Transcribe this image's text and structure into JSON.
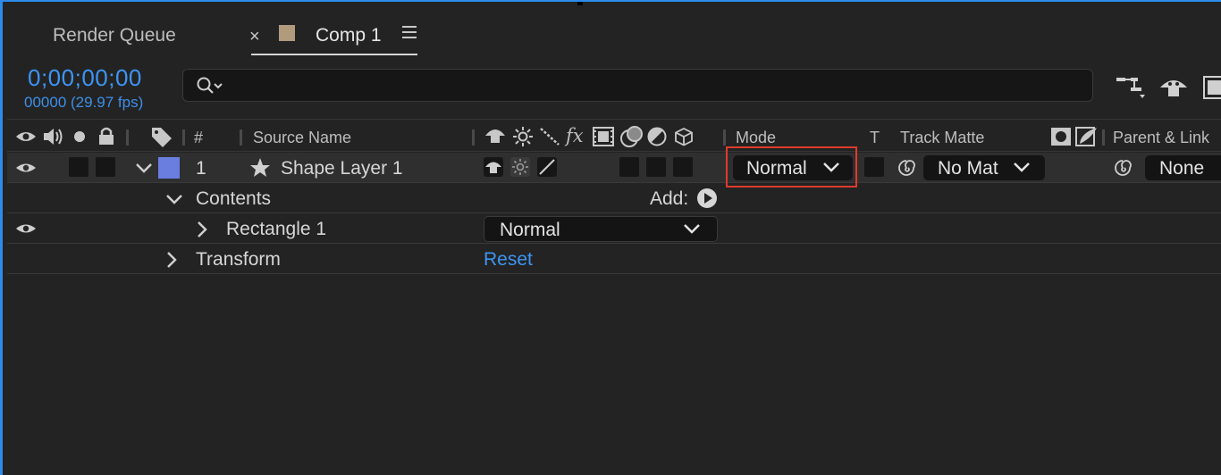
{
  "tabs": {
    "render_queue": "Render Queue",
    "close_glyph": "×",
    "comp": "Comp 1",
    "comp_color": "#b09b7d"
  },
  "timecode": "0;00;00;00",
  "frame_info": "00000 (29.97 fps)",
  "search": {
    "value": "",
    "placeholder": ""
  },
  "columns": {
    "hash": "#",
    "source_name": "Source Name",
    "fx": "fx",
    "mode": "Mode",
    "t": "T",
    "track_matte": "Track Matte",
    "parent_link": "Parent & Link"
  },
  "layer": {
    "number": "1",
    "name": "Shape Layer 1",
    "label_color": "#6a7ee0",
    "mode": "Normal",
    "track_matte": "No Mat",
    "parent": "None"
  },
  "contents": {
    "label": "Contents",
    "add_label": "Add:"
  },
  "rectangle": {
    "name": "Rectangle 1",
    "blend_mode": "Normal"
  },
  "transform": {
    "label": "Transform",
    "reset": "Reset"
  },
  "colors": {
    "accent": "#3d95f5",
    "highlight": "#e03a2b",
    "panel_bg": "#232323"
  }
}
